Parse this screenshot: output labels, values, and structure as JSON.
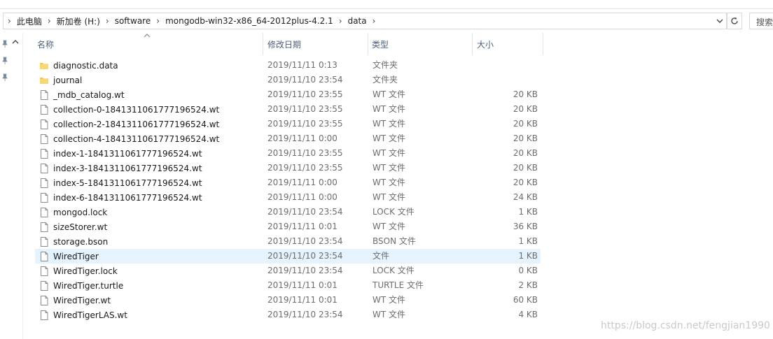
{
  "breadcrumbs": [
    "此电脑",
    "新加卷 (H:)",
    "software",
    "mongodb-win32-x86_64-2012plus-4.2.1",
    "data"
  ],
  "search": {
    "placeholder": "搜索"
  },
  "columns": {
    "name": "名称",
    "date": "修改日期",
    "type": "类型",
    "size": "大小"
  },
  "files": [
    {
      "name": "diagnostic.data",
      "date": "2019/11/11 0:13",
      "type": "文件夹",
      "size": "",
      "kind": "folder"
    },
    {
      "name": "journal",
      "date": "2019/11/10 23:54",
      "type": "文件夹",
      "size": "",
      "kind": "folder"
    },
    {
      "name": "_mdb_catalog.wt",
      "date": "2019/11/10 23:55",
      "type": "WT 文件",
      "size": "20 KB",
      "kind": "file"
    },
    {
      "name": "collection-0-1841311061777196524.wt",
      "date": "2019/11/10 23:55",
      "type": "WT 文件",
      "size": "20 KB",
      "kind": "file"
    },
    {
      "name": "collection-2-1841311061777196524.wt",
      "date": "2019/11/10 23:55",
      "type": "WT 文件",
      "size": "20 KB",
      "kind": "file"
    },
    {
      "name": "collection-4-1841311061777196524.wt",
      "date": "2019/11/11 0:00",
      "type": "WT 文件",
      "size": "20 KB",
      "kind": "file"
    },
    {
      "name": "index-1-1841311061777196524.wt",
      "date": "2019/11/10 23:55",
      "type": "WT 文件",
      "size": "20 KB",
      "kind": "file"
    },
    {
      "name": "index-3-1841311061777196524.wt",
      "date": "2019/11/10 23:55",
      "type": "WT 文件",
      "size": "20 KB",
      "kind": "file"
    },
    {
      "name": "index-5-1841311061777196524.wt",
      "date": "2019/11/11 0:00",
      "type": "WT 文件",
      "size": "20 KB",
      "kind": "file"
    },
    {
      "name": "index-6-1841311061777196524.wt",
      "date": "2019/11/11 0:00",
      "type": "WT 文件",
      "size": "24 KB",
      "kind": "file"
    },
    {
      "name": "mongod.lock",
      "date": "2019/11/10 23:54",
      "type": "LOCK 文件",
      "size": "1 KB",
      "kind": "file"
    },
    {
      "name": "sizeStorer.wt",
      "date": "2019/11/11 0:01",
      "type": "WT 文件",
      "size": "36 KB",
      "kind": "file"
    },
    {
      "name": "storage.bson",
      "date": "2019/11/10 23:54",
      "type": "BSON 文件",
      "size": "1 KB",
      "kind": "file"
    },
    {
      "name": "WiredTiger",
      "date": "2019/11/10 23:54",
      "type": "文件",
      "size": "1 KB",
      "kind": "file",
      "selected": true
    },
    {
      "name": "WiredTiger.lock",
      "date": "2019/11/10 23:54",
      "type": "LOCK 文件",
      "size": "0 KB",
      "kind": "file"
    },
    {
      "name": "WiredTiger.turtle",
      "date": "2019/11/11 0:01",
      "type": "TURTLE 文件",
      "size": "2 KB",
      "kind": "file"
    },
    {
      "name": "WiredTiger.wt",
      "date": "2019/11/11 0:01",
      "type": "WT 文件",
      "size": "60 KB",
      "kind": "file"
    },
    {
      "name": "WiredTigerLAS.wt",
      "date": "2019/11/10 23:54",
      "type": "WT 文件",
      "size": "4 KB",
      "kind": "file"
    }
  ],
  "icons": {
    "folder": "folder-icon",
    "file": "file-icon",
    "pin": "pin-icon"
  },
  "colors": {
    "selected_row": "#e5f3ff",
    "header_text": "#4c607a",
    "folder": "#f4c542"
  },
  "watermark": "https://blog.csdn.net/fengjian1990"
}
